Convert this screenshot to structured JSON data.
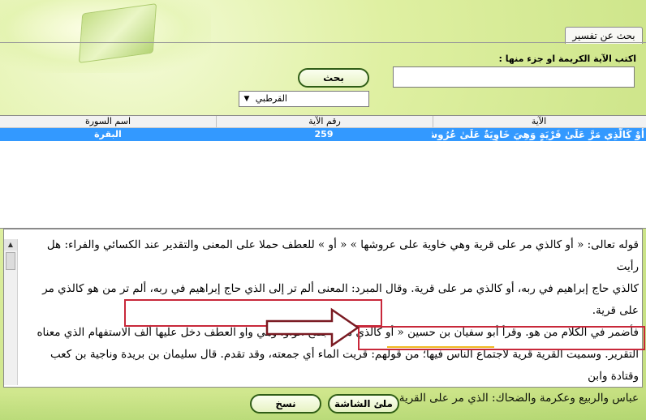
{
  "tab": {
    "label": "بحث عن تفسير"
  },
  "search": {
    "prompt": "اكتب الآية الكريمة او جزء منها :",
    "value": "",
    "button_label": "بحث"
  },
  "tafsir_select": {
    "selected": "القرطبي"
  },
  "table": {
    "headers": {
      "aya": "الآية",
      "aya_number": "رقم الآية",
      "surah_name": "اسم السورة"
    },
    "rows": [
      {
        "aya": "أَوْ كَالَّذِي مَرَّ عَلَىٰ قَرْيَةٍ وَهِيَ خَاوِيَةٌ عَلَىٰ عُرُوشِ",
        "aya_number": "259",
        "surah_name": "البقرة"
      }
    ]
  },
  "tafsir_text": {
    "line1": "قوله تعالى: « أو كالذي مر على قرية وهي خاوية على عروشها » « أو » للعطف حملا على المعنى والتقدير عند الكسائي والفراء: هل رأيت",
    "line2": "كالذي حاج إبراهيم في ربه، أو كالذي مر على قرية. وقال المبرد: المعنى ألم تر إلى الذي حاج إبراهيم في ربه، ألم تر من هو كالذي مر على قرية.",
    "line3": "فأضمر في الكلام من هو. وقرأ أبو سفيان بن حسين « أو كالذي مر » بفتح الواو، وهي واو العطف دخل عليها ألف الاستفهام الذي معناه",
    "line4": "التقرير. وسميت القرية قرية لاجتماع الناس فيها؛ من قولهم: قريت الماء أي جمعته، وقد تقدم. قال سليمان بن بريدة وناجية بن كعب وقتادة وابن",
    "line5": "عباس والربيع وعكرمة والضحاك: الذي مر على القرية هو عزير."
  },
  "buttons": {
    "copy_label": "نسخ",
    "fullscreen_label": "ملئ الشاشة"
  },
  "colors": {
    "selection": "#3399ff",
    "highlight_border": "#c8283a",
    "underline": "#f0b820",
    "button_border": "#2f5d16"
  }
}
